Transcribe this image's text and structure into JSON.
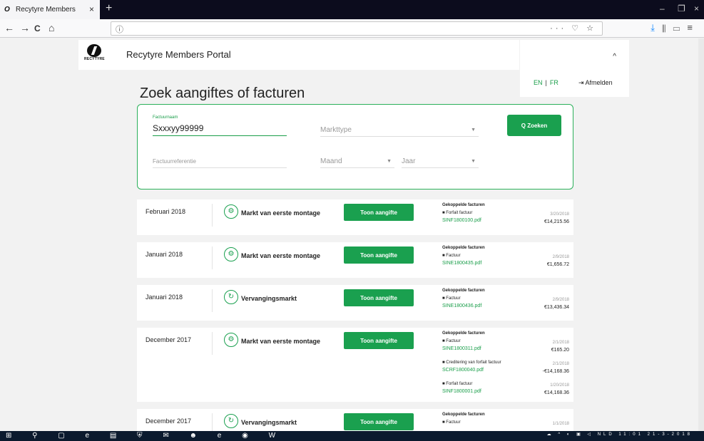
{
  "browser": {
    "tab_title": "Recytyre Members",
    "tab_close": "×",
    "new_tab": "+",
    "url_info": "ⓘ",
    "url_actions": "··· ♡ ☆",
    "toolbar_download": "⤓",
    "toolbar_library": "⫴",
    "toolbar_sidebar": "▭",
    "toolbar_menu": "≡",
    "nav_back": "←",
    "nav_forward": "→",
    "nav_reload": "C",
    "nav_home": "⌂",
    "win_minimize": "–",
    "win_restore": "❐",
    "win_close": "×"
  },
  "header": {
    "logo_text": "RECYTYRE",
    "portal_title": "Recytyre Members Portal",
    "lang_en": "EN",
    "lang_sep": "|",
    "lang_fr": "FR",
    "logout": "Afmelden",
    "collapse": "^"
  },
  "search": {
    "page_title": "Zoek aangiftes of facturen",
    "invoice_name_label": "Factuurnaam",
    "invoice_name_value": "Sxxxyy99999",
    "market_type_placeholder": "Markttype",
    "invoice_ref_placeholder": "Factuurreferentie",
    "month_placeholder": "Maand",
    "year_placeholder": "Jaar",
    "search_button": "Q Zoeken",
    "select_arrow": "▼"
  },
  "results": [
    {
      "period": "Februari 2018",
      "market": "Markt van eerste montage",
      "button": "Toon aangifte",
      "invoices_title": "Gekoppelde facturen",
      "invoices": [
        {
          "type": "Forfait factuur",
          "file": "SINF1800100.pdf",
          "date": "3/20/2018",
          "amount": "€14,215.56"
        }
      ]
    },
    {
      "period": "Januari 2018",
      "market": "Markt van eerste montage",
      "button": "Toon aangifte",
      "invoices_title": "Gekoppelde facturen",
      "invoices": [
        {
          "type": "Factuur",
          "file": "SINE1800435.pdf",
          "date": "2/9/2018",
          "amount": "€1,656.72"
        }
      ]
    },
    {
      "period": "Januari 2018",
      "market": "Vervangingsmarkt",
      "button": "Toon aangifte",
      "invoices_title": "Gekoppelde facturen",
      "invoices": [
        {
          "type": "Factuur",
          "file": "SINE1800436.pdf",
          "date": "2/9/2018",
          "amount": "€13,436.34"
        }
      ]
    },
    {
      "period": "December 2017",
      "market": "Markt van eerste montage",
      "button": "Toon aangifte",
      "invoices_title": "Gekoppelde facturen",
      "invoices": [
        {
          "type": "Factuur",
          "file": "SINE1800311.pdf",
          "date": "2/1/2018",
          "amount": "€165.20"
        },
        {
          "type": "Creditering van forfait factuur",
          "file": "SCRF1800040.pdf",
          "date": "2/1/2018",
          "amount": "-€14,168.36"
        },
        {
          "type": "Forfait factuur",
          "file": "SINF1800001.pdf",
          "date": "1/20/2018",
          "amount": "€14,168.36"
        }
      ]
    },
    {
      "period": "December 2017",
      "market": "Vervangingsmarkt",
      "button": "Toon aangifte",
      "invoices_title": "Gekoppelde facturen",
      "invoices": [
        {
          "type": "Factuur",
          "file": "",
          "date": "1/1/2018",
          "amount": ""
        }
      ]
    }
  ],
  "taskbar": {
    "icons": "⊞ ⚲ ▢ e ▤ ⛨ ✉ ☻ e ◉ W",
    "tray": "☁ ^ ◐ ▣ ◁ NLD",
    "time": "11:01",
    "date": "21-3-2018"
  },
  "colors": {
    "brand_green": "#1aa04f",
    "title_bar": "#0c0c1d"
  }
}
